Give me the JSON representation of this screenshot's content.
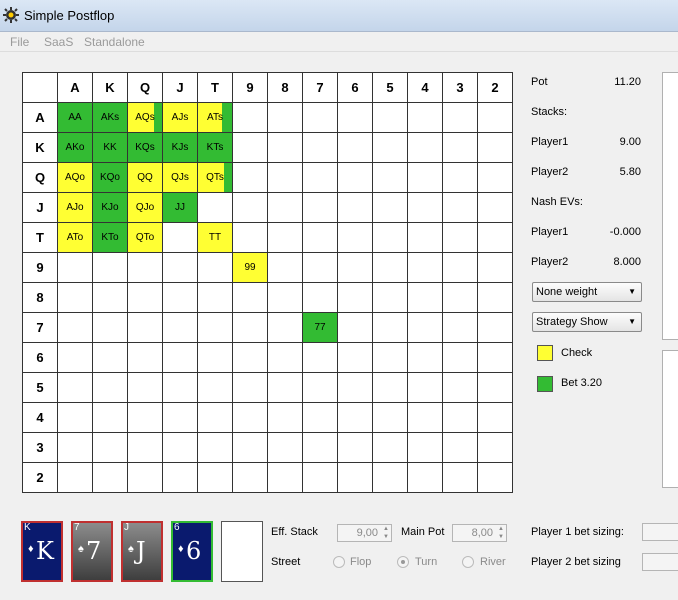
{
  "window": {
    "title": "Simple Postflop"
  },
  "menu": [
    "File",
    "SaaS",
    "Standalone"
  ],
  "grid": {
    "headers": [
      "A",
      "K",
      "Q",
      "J",
      "T",
      "9",
      "8",
      "7",
      "6",
      "5",
      "4",
      "3",
      "2"
    ],
    "cells": [
      {
        "row": 0,
        "col": 0,
        "label": "AA",
        "fill": [
          [
            "#33bb33",
            1
          ]
        ]
      },
      {
        "row": 0,
        "col": 1,
        "label": "AKs",
        "fill": [
          [
            "#33bb33",
            1
          ]
        ]
      },
      {
        "row": 0,
        "col": 2,
        "label": "AQs",
        "fill": [
          [
            "#ffff33",
            0.75
          ],
          [
            "#33bb33",
            0.25
          ]
        ]
      },
      {
        "row": 0,
        "col": 3,
        "label": "AJs",
        "fill": [
          [
            "#ffff33",
            1
          ]
        ]
      },
      {
        "row": 0,
        "col": 4,
        "label": "ATs",
        "fill": [
          [
            "#ffff33",
            0.72
          ],
          [
            "#33bb33",
            0.28
          ]
        ]
      },
      {
        "row": 1,
        "col": 0,
        "label": "AKo",
        "fill": [
          [
            "#33bb33",
            1
          ]
        ]
      },
      {
        "row": 1,
        "col": 1,
        "label": "KK",
        "fill": [
          [
            "#33bb33",
            1
          ]
        ]
      },
      {
        "row": 1,
        "col": 2,
        "label": "KQs",
        "fill": [
          [
            "#33bb33",
            1
          ]
        ]
      },
      {
        "row": 1,
        "col": 3,
        "label": "KJs",
        "fill": [
          [
            "#33bb33",
            1
          ]
        ]
      },
      {
        "row": 1,
        "col": 4,
        "label": "KTs",
        "fill": [
          [
            "#33bb33",
            1
          ]
        ]
      },
      {
        "row": 2,
        "col": 0,
        "label": "AQo",
        "fill": [
          [
            "#ffff33",
            1
          ]
        ]
      },
      {
        "row": 2,
        "col": 1,
        "label": "KQo",
        "fill": [
          [
            "#33bb33",
            1
          ]
        ]
      },
      {
        "row": 2,
        "col": 2,
        "label": "QQ",
        "fill": [
          [
            "#ffff33",
            1
          ]
        ]
      },
      {
        "row": 2,
        "col": 3,
        "label": "QJs",
        "fill": [
          [
            "#ffff33",
            1
          ]
        ]
      },
      {
        "row": 2,
        "col": 4,
        "label": "QTs",
        "fill": [
          [
            "#ffff33",
            0.75
          ],
          [
            "#33bb33",
            0.25
          ]
        ]
      },
      {
        "row": 3,
        "col": 0,
        "label": "AJo",
        "fill": [
          [
            "#ffff33",
            1
          ]
        ]
      },
      {
        "row": 3,
        "col": 1,
        "label": "KJo",
        "fill": [
          [
            "#33bb33",
            1
          ]
        ]
      },
      {
        "row": 3,
        "col": 2,
        "label": "QJo",
        "fill": [
          [
            "#ffff33",
            1
          ]
        ]
      },
      {
        "row": 3,
        "col": 3,
        "label": "JJ",
        "fill": [
          [
            "#33bb33",
            1
          ]
        ]
      },
      {
        "row": 4,
        "col": 0,
        "label": "ATo",
        "fill": [
          [
            "#ffff33",
            1
          ]
        ]
      },
      {
        "row": 4,
        "col": 1,
        "label": "KTo",
        "fill": [
          [
            "#33bb33",
            1
          ]
        ]
      },
      {
        "row": 4,
        "col": 2,
        "label": "QTo",
        "fill": [
          [
            "#ffff33",
            1
          ]
        ]
      },
      {
        "row": 4,
        "col": 4,
        "label": "TT",
        "fill": [
          [
            "#ffff33",
            1
          ]
        ]
      },
      {
        "row": 5,
        "col": 5,
        "label": "99",
        "fill": [
          [
            "#ffff33",
            1
          ]
        ]
      },
      {
        "row": 7,
        "col": 7,
        "label": "77",
        "fill": [
          [
            "#33bb33",
            1
          ]
        ]
      }
    ]
  },
  "info": {
    "pot_label": "Pot",
    "pot_value": "11.20",
    "stacks_label": "Stacks:",
    "p1_label": "Player1",
    "p1_stack": "9.00",
    "p2_label": "Player2",
    "p2_stack": "5.80",
    "nash_label": "Nash EVs:",
    "p1_ev_label": "Player1",
    "p1_ev": "-0.000",
    "p2_ev_label": "Player2",
    "p2_ev": "8.000"
  },
  "controls": {
    "weight_select": "None weight",
    "strategy_select": "Strategy Show"
  },
  "legend": [
    {
      "label": "Check",
      "color": "#ffff33"
    },
    {
      "label": "Bet 3.20",
      "color": "#33bb33"
    }
  ],
  "cards": [
    {
      "rank": "K",
      "suit": "♦",
      "style": "blue"
    },
    {
      "rank": "7",
      "suit": "♠",
      "style": "gray"
    },
    {
      "rank": "J",
      "suit": "♠",
      "style": "gray"
    },
    {
      "rank": "6",
      "suit": "♦",
      "style": "navy"
    }
  ],
  "bottom": {
    "eff_stack_label": "Eff. Stack",
    "eff_stack_value": "9,00",
    "main_pot_label": "Main Pot",
    "main_pot_value": "8,00",
    "street_label": "Street",
    "street_options": [
      "Flop",
      "Turn",
      "River"
    ],
    "street_selected": "Turn",
    "p1_bet_label": "Player 1 bet sizing:",
    "p2_bet_label": "Player 2 bet sizing"
  }
}
